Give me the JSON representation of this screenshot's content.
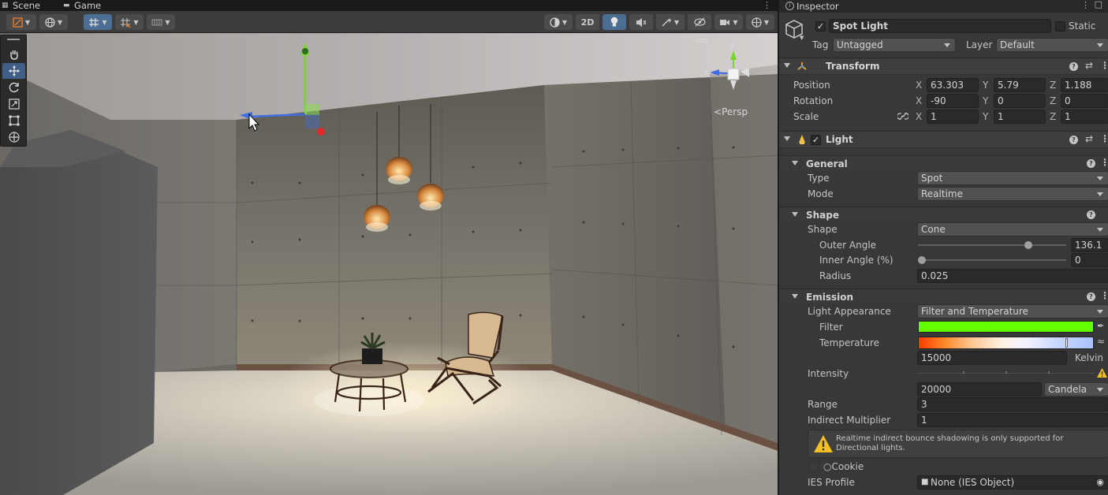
{
  "scene_tabs": [
    {
      "label": "Scene",
      "icon": "scene-grid-icon"
    },
    {
      "label": "Game",
      "icon": "gamepad-icon"
    }
  ],
  "toolbar": {
    "view_2d_label": "2D"
  },
  "viewport": {
    "projection_label": "Persp",
    "gizmo_axes": {
      "x": "x",
      "y": "y",
      "z": "z"
    }
  },
  "colors": {
    "filter": "#66ff00",
    "selected_tool": "#3f5f86",
    "active_toolbar": "#4d6e94",
    "warning": "#f4bf24"
  },
  "inspector": {
    "tab_label": "Inspector",
    "object": {
      "name": "Spot Light",
      "active": true,
      "static_label": "Static",
      "tag_label": "Tag",
      "tag_value": "Untagged",
      "layer_label": "Layer",
      "layer_value": "Default"
    },
    "transform": {
      "title": "Transform",
      "position_label": "Position",
      "rotation_label": "Rotation",
      "scale_label": "Scale",
      "position": {
        "x": "63.303",
        "y": "5.79",
        "z": "1.188"
      },
      "rotation": {
        "x": "-90",
        "y": "0",
        "z": "0"
      },
      "scale": {
        "x": "1",
        "y": "1",
        "z": "1"
      },
      "axis_labels": {
        "x": "X",
        "y": "Y",
        "z": "Z"
      }
    },
    "light": {
      "title": "Light",
      "enabled": true,
      "general": {
        "title": "General",
        "type_label": "Type",
        "type_value": "Spot",
        "mode_label": "Mode",
        "mode_value": "Realtime"
      },
      "shape": {
        "title": "Shape",
        "shape_label": "Shape",
        "shape_value": "Cone",
        "outer_angle_label": "Outer Angle",
        "outer_angle_value": "136.1",
        "outer_angle_fraction": 0.756,
        "inner_angle_label": "Inner Angle (%)",
        "inner_angle_value": "0",
        "inner_angle_fraction": 0.0,
        "radius_label": "Radius",
        "radius_value": "0.025"
      },
      "emission": {
        "title": "Emission",
        "light_appearance_label": "Light Appearance",
        "light_appearance_value": "Filter and Temperature",
        "filter_label": "Filter",
        "temperature_label": "Temperature",
        "temperature_value": "15000",
        "temperature_unit": "Kelvin",
        "intensity_label": "Intensity",
        "intensity_value": "20000",
        "intensity_unit": "Candela",
        "range_label": "Range",
        "range_value": "3",
        "indirect_label": "Indirect Multiplier",
        "indirect_value": "1",
        "warning_text": "Realtime indirect bounce shadowing is only supported for Directional lights.",
        "cookie_label": "Cookie",
        "ies_label": "IES Profile",
        "ies_value": "None (IES Object)"
      }
    }
  }
}
